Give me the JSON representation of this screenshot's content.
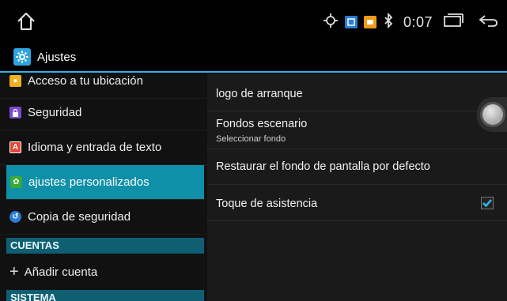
{
  "status_bar": {
    "time": "0:07",
    "icons": [
      "home-icon",
      "location-icon",
      "blue-notification-icon",
      "orange-notification-icon",
      "bluetooth-icon",
      "recent-apps-icon",
      "back-icon"
    ]
  },
  "app_bar": {
    "title": "Ajustes",
    "icon": "settings-icon"
  },
  "left_panel": {
    "items": [
      {
        "label": "Acceso a tu ubicación",
        "icon": "location-access-icon"
      },
      {
        "label": "Seguridad",
        "icon": "lock-icon"
      },
      {
        "label": "Idioma y entrada de texto",
        "icon": "language-icon"
      },
      {
        "label": "ajustes personalizados",
        "icon": "custom-settings-icon"
      },
      {
        "label": "Copia de seguridad",
        "icon": "backup-icon"
      }
    ],
    "section_accounts": "CUENTAS",
    "add_account": "Añadir cuenta",
    "section_system": "SISTEMA"
  },
  "right_panel": {
    "items": [
      {
        "title": "logo de arranque",
        "subtitle": ""
      },
      {
        "title": "Fondos escenario",
        "subtitle": "Seleccionar fondo"
      },
      {
        "title": "Restaurar el fondo de pantalla por defecto",
        "subtitle": ""
      },
      {
        "title": "Toque de asistencia",
        "subtitle": "",
        "checked": true
      }
    ]
  },
  "colors": {
    "accent": "#33b5e5",
    "selected_item": "#0f8fa8",
    "section_header": "#0f5f73"
  }
}
